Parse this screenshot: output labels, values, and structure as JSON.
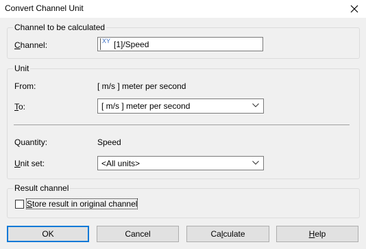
{
  "window": {
    "title": "Convert Channel Unit",
    "close_icon": "close-icon"
  },
  "channel_group": {
    "legend": "Channel to be calculated",
    "channel_label": "Channel:",
    "channel_icon_text": "XY",
    "channel_value": "[1]/Speed"
  },
  "unit_group": {
    "legend": "Unit",
    "from_label": "From:",
    "from_value": "[ m/s ]  meter per second",
    "to_label": "To:",
    "to_value": "[ m/s ] meter per second",
    "quantity_label": "Quantity:",
    "quantity_value": "Speed",
    "unit_set_label": "Unit set:",
    "unit_set_value": "<All units>"
  },
  "result_group": {
    "legend": "Result channel",
    "store_label": "Store result in original channel",
    "store_checked": false
  },
  "buttons": {
    "ok": "OK",
    "cancel": "Cancel",
    "calculate": "Calculate",
    "help": "Help"
  }
}
